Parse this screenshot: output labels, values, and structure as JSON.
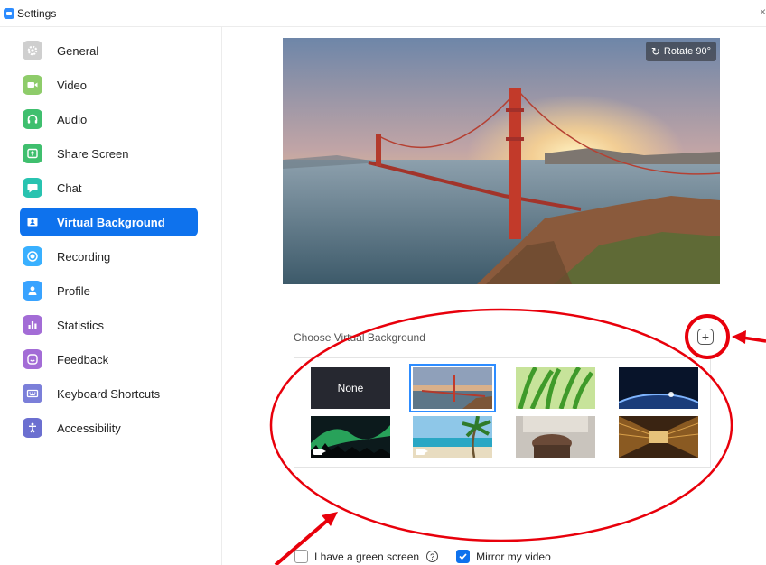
{
  "window": {
    "title": "Settings",
    "close_glyph": "×"
  },
  "sidebar": {
    "items": [
      {
        "label": "General",
        "icon": "gear-icon",
        "color": "#c9c9c9",
        "active": false
      },
      {
        "label": "Video",
        "icon": "video-camera-icon",
        "color": "#8ecc6a",
        "active": false
      },
      {
        "label": "Audio",
        "icon": "headphones-icon",
        "color": "#3fbf6e",
        "active": false
      },
      {
        "label": "Share Screen",
        "icon": "share-screen-icon",
        "color": "#3fbf6e",
        "active": false
      },
      {
        "label": "Chat",
        "icon": "chat-bubble-icon",
        "color": "#28c3b0",
        "active": false
      },
      {
        "label": "Virtual Background",
        "icon": "person-card-icon",
        "color": "#0e72ed",
        "active": true
      },
      {
        "label": "Recording",
        "icon": "record-icon",
        "color": "#39b0ff",
        "active": false
      },
      {
        "label": "Profile",
        "icon": "person-icon",
        "color": "#39a3ff",
        "active": false
      },
      {
        "label": "Statistics",
        "icon": "bar-chart-icon",
        "color": "#a36cd6",
        "active": false
      },
      {
        "label": "Feedback",
        "icon": "smiley-icon",
        "color": "#a36cd6",
        "active": false
      },
      {
        "label": "Keyboard Shortcuts",
        "icon": "keyboard-icon",
        "color": "#7b7fd9",
        "active": false
      },
      {
        "label": "Accessibility",
        "icon": "accessibility-icon",
        "color": "#6b6fd0",
        "active": false
      }
    ]
  },
  "preview": {
    "rotate_label": "Rotate 90°"
  },
  "choose": {
    "label": "Choose Virtual Background",
    "add_glyph": "+"
  },
  "gallery": {
    "thumbnails": [
      {
        "name": "none",
        "label": "None",
        "selected": false,
        "video": false
      },
      {
        "name": "golden-gate-bridge",
        "selected": true,
        "video": false
      },
      {
        "name": "grass",
        "selected": false,
        "video": false
      },
      {
        "name": "earth-from-space",
        "selected": false,
        "video": false
      },
      {
        "name": "aurora",
        "selected": false,
        "video": true
      },
      {
        "name": "beach-palm",
        "selected": false,
        "video": true
      },
      {
        "name": "office-room",
        "selected": false,
        "video": false
      },
      {
        "name": "library-hall",
        "selected": false,
        "video": false
      }
    ]
  },
  "options": {
    "green_screen_label": "I have a green screen",
    "green_screen_checked": false,
    "help_glyph": "?",
    "mirror_label": "Mirror my video",
    "mirror_checked": true
  },
  "colors": {
    "accent": "#0e72ed",
    "annotation": "#e8000b"
  }
}
